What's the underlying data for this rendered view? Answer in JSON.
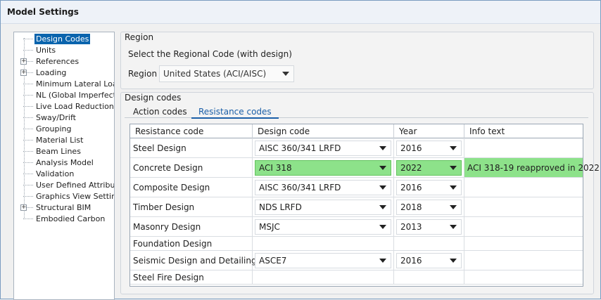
{
  "window": {
    "title": "Model Settings"
  },
  "tree": {
    "items": [
      {
        "label": "Design Codes",
        "selected": true,
        "expandable": false
      },
      {
        "label": "Units",
        "selected": false,
        "expandable": false
      },
      {
        "label": "References",
        "selected": false,
        "expandable": true
      },
      {
        "label": "Loading",
        "selected": false,
        "expandable": true
      },
      {
        "label": "Minimum Lateral Loads",
        "selected": false,
        "expandable": false
      },
      {
        "label": "NL (Global Imperfectio",
        "selected": false,
        "expandable": false
      },
      {
        "label": "Live Load Reduction",
        "selected": false,
        "expandable": false
      },
      {
        "label": "Sway/Drift",
        "selected": false,
        "expandable": false
      },
      {
        "label": "Grouping",
        "selected": false,
        "expandable": false
      },
      {
        "label": "Material List",
        "selected": false,
        "expandable": false
      },
      {
        "label": "Beam Lines",
        "selected": false,
        "expandable": false
      },
      {
        "label": "Analysis Model",
        "selected": false,
        "expandable": false
      },
      {
        "label": "Validation",
        "selected": false,
        "expandable": false
      },
      {
        "label": "User Defined Attributes",
        "selected": false,
        "expandable": false
      },
      {
        "label": "Graphics View Settings",
        "selected": false,
        "expandable": false
      },
      {
        "label": "Structural BIM",
        "selected": false,
        "expandable": true
      },
      {
        "label": "Embodied Carbon",
        "selected": false,
        "expandable": false
      }
    ]
  },
  "region": {
    "group_title": "Region",
    "prompt": "Select the Regional Code (with design)",
    "label": "Region",
    "value": "United States (ACI/AISC)"
  },
  "design_codes": {
    "group_title": "Design codes",
    "tabs": [
      {
        "label": "Action codes",
        "active": false
      },
      {
        "label": "Resistance codes",
        "active": true
      }
    ],
    "columns": [
      "Resistance code",
      "Design code",
      "Year",
      "Info text"
    ],
    "rows": [
      {
        "name": "Steel Design",
        "code": "AISC 360/341 LRFD",
        "year": "2016",
        "info": "",
        "highlight": false
      },
      {
        "name": "Concrete Design",
        "code": "ACI 318",
        "year": "2022",
        "info": "ACI 318-19 reapproved in 2022",
        "highlight": true
      },
      {
        "name": "Composite Design",
        "code": "AISC 360/341 LRFD",
        "year": "2016",
        "info": "",
        "highlight": false
      },
      {
        "name": "Timber Design",
        "code": "NDS LRFD",
        "year": "2018",
        "info": "",
        "highlight": false
      },
      {
        "name": "Masonry Design",
        "code": "MSJC",
        "year": "2013",
        "info": "",
        "highlight": false
      },
      {
        "name": "Foundation Design",
        "code": "",
        "year": "",
        "info": "",
        "highlight": false
      },
      {
        "name": "Seismic Design and Detailing",
        "code": "ASCE7",
        "year": "2016",
        "info": "",
        "highlight": false
      },
      {
        "name": "Steel Fire Design",
        "code": "",
        "year": "",
        "info": "",
        "highlight": false
      }
    ]
  },
  "colors": {
    "highlight": "#8de28a",
    "selection": "#0a64ad",
    "tab_active": "#1b5fa8"
  }
}
